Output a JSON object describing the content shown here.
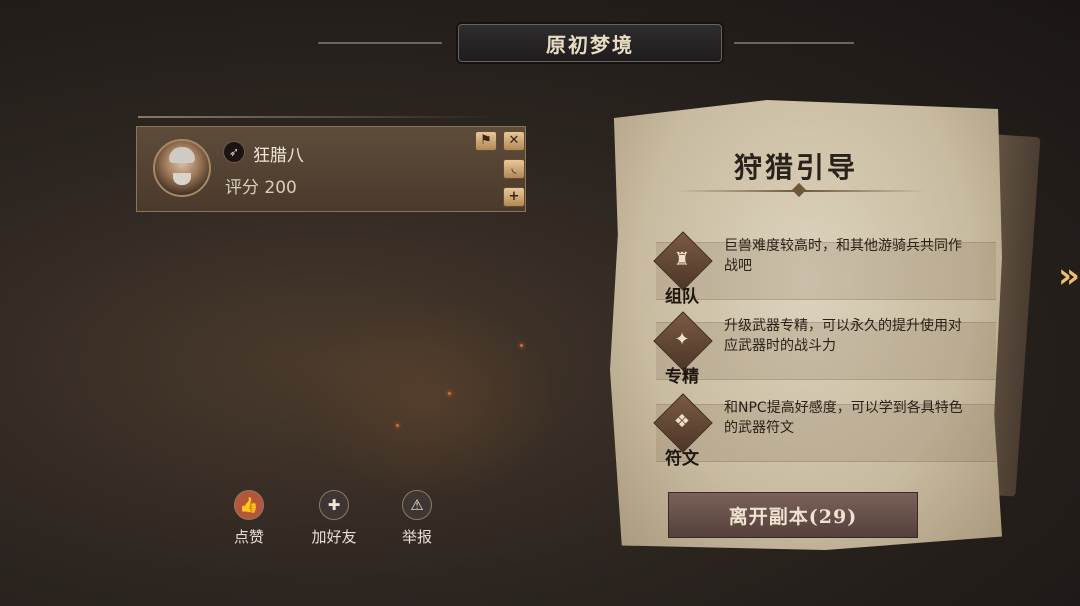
{
  "header": {
    "title": "原初梦境"
  },
  "player": {
    "name": "狂腊八",
    "score": "评分 200",
    "class_icon": "bow-icon",
    "side_buttons": [
      {
        "icon": "run-icon",
        "glyph": "⚑"
      },
      {
        "icon": "crossed-swords-icon",
        "glyph": "✕"
      },
      {
        "icon": "horn-icon",
        "glyph": "◟"
      },
      {
        "icon": "plus-icon",
        "glyph": "+"
      }
    ]
  },
  "actions": [
    {
      "label": "点赞",
      "icon": "thumbs-up-icon",
      "glyph": "👍",
      "color": "#b4563a"
    },
    {
      "label": "加好友",
      "icon": "add-friend-icon",
      "glyph": "✚",
      "color": "#3e3632"
    },
    {
      "label": "举报",
      "icon": "warning-icon",
      "glyph": "⚠",
      "color": "#3e3632"
    }
  ],
  "guide": {
    "title": "狩猎引导",
    "tips": [
      {
        "label": "组队",
        "icon": "helmet-icon",
        "glyph": "♜",
        "text": "巨兽难度较高时，和其他游骑兵共同作战吧"
      },
      {
        "label": "专精",
        "icon": "mastery-icon",
        "glyph": "✦",
        "text": "升级武器专精，可以永久的提升使用对应武器时的战斗力"
      },
      {
        "label": "符文",
        "icon": "rune-icon",
        "glyph": "❖",
        "text": "和NPC提高好感度，可以学到各具特色的武器符文"
      }
    ],
    "leave_button": "离开副本(29)"
  },
  "nav": {
    "next_icon": "chevron-right-icon",
    "glyph": "»"
  }
}
